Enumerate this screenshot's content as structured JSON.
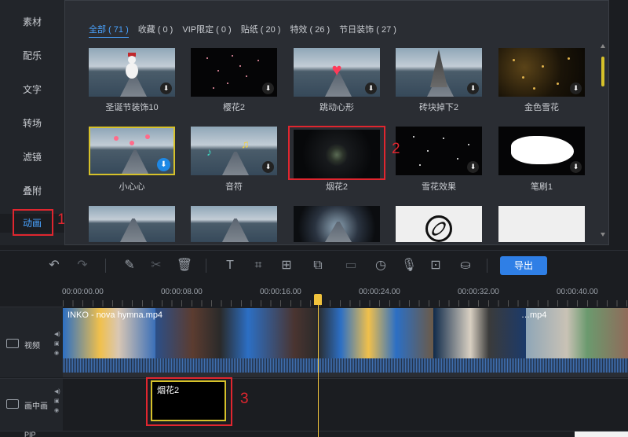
{
  "sidebar": {
    "items": [
      {
        "label": "素材"
      },
      {
        "label": "配乐"
      },
      {
        "label": "文字"
      },
      {
        "label": "转场"
      },
      {
        "label": "滤镜"
      },
      {
        "label": "叠附"
      },
      {
        "label": "动画"
      }
    ],
    "active_index": 6,
    "annotation": "1"
  },
  "library": {
    "tabs": [
      {
        "label": "全部 ( 71 )"
      },
      {
        "label": "收藏 ( 0 )"
      },
      {
        "label": "VIP限定 ( 0 )"
      },
      {
        "label": "贴纸 ( 20 )"
      },
      {
        "label": "特效 ( 26 )"
      },
      {
        "label": "节日装饰 ( 27 )"
      }
    ],
    "items": [
      {
        "caption": "圣诞节装饰10",
        "icon": "snowman-icon"
      },
      {
        "caption": "樱花2",
        "icon": "sakura-icon"
      },
      {
        "caption": "跳动心形",
        "icon": "heart-icon"
      },
      {
        "caption": "砖块掉下2",
        "icon": "bricks-icon"
      },
      {
        "caption": "金色雪花",
        "icon": "gold-snow-icon"
      },
      {
        "caption": "小心心",
        "icon": "hearts-icon"
      },
      {
        "caption": "音符",
        "icon": "music-note-icon"
      },
      {
        "caption": "烟花2",
        "icon": "firework-icon"
      },
      {
        "caption": "雪花效果",
        "icon": "snow-icon"
      },
      {
        "caption": "笔刷1",
        "icon": "brush-icon"
      }
    ],
    "annotation": "2"
  },
  "toolbar": {
    "export_label": "导出"
  },
  "timeline": {
    "ticks": [
      "00:00:00.00",
      "00:00:08.00",
      "00:00:16.00",
      "00:00:24.00",
      "00:00:32.00",
      "00:00:40.00"
    ],
    "video_track_label": "视频",
    "pip_track_label": "画中画",
    "pip_bottom_label": "PIP",
    "video_clip_title": "INKO - nova hymna.mp4",
    "video_clip_title2": "…mp4",
    "pip_clip_label": "烟花2",
    "annotation": "3"
  },
  "colors": {
    "accent": "#4aa3ff",
    "highlight": "#e0262f",
    "playhead": "#f0c23c",
    "export": "#2f7fe6"
  }
}
